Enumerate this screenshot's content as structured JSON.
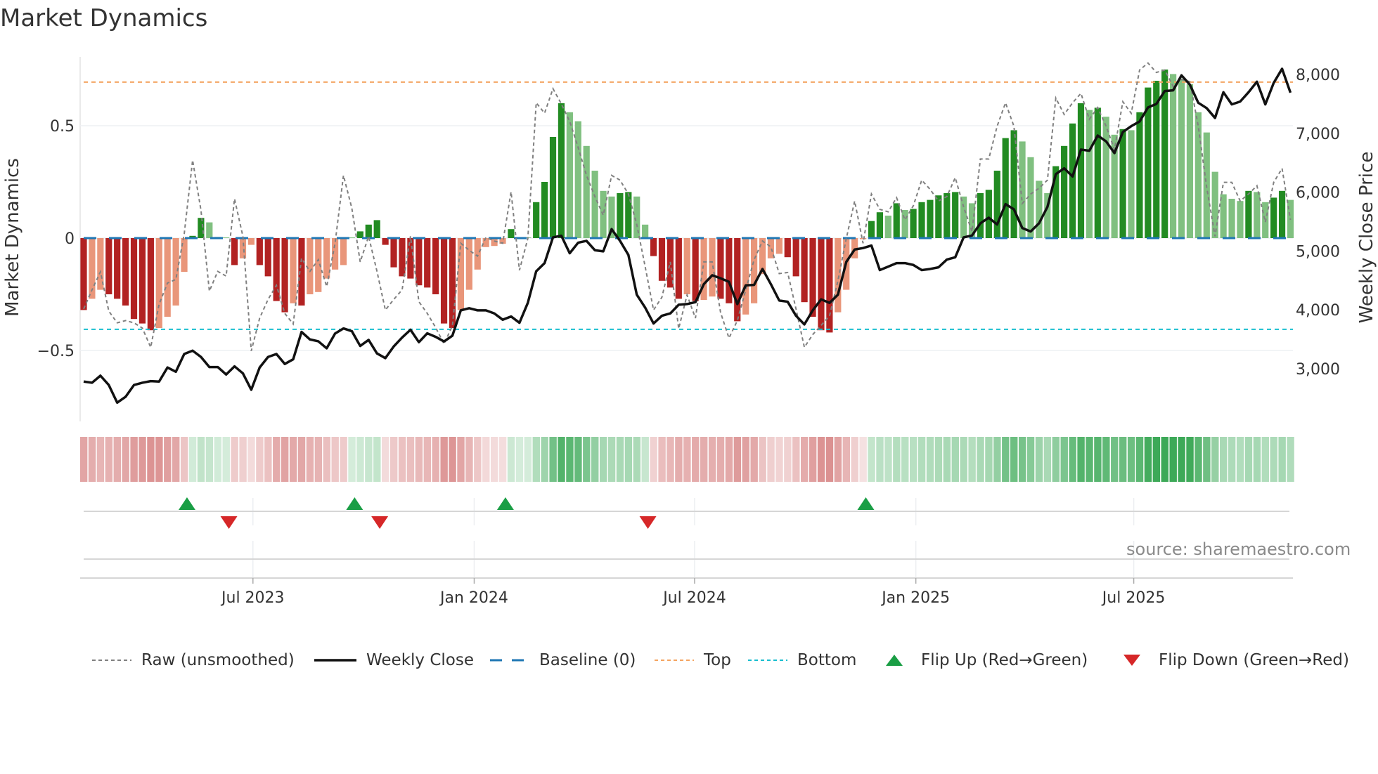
{
  "chart_data": {
    "type": "bar",
    "title": "Market Dynamics",
    "ylabel": "Market Dynamics",
    "y2label": "Weekly Close Price",
    "ylim": [
      -0.82,
      0.82
    ],
    "y2lim": [
      2000,
      8240
    ],
    "yticks": [
      {
        "value": 0.5,
        "label": "0.5"
      },
      {
        "value": 0,
        "label": "0"
      },
      {
        "value": -0.5,
        "label": "−0.5"
      }
    ],
    "y2ticks": [
      {
        "value": 8000,
        "label": "8,000"
      },
      {
        "value": 7000,
        "label": "7,000"
      },
      {
        "value": 6000,
        "label": "6,000"
      },
      {
        "value": 5000,
        "label": "5,000"
      },
      {
        "value": 4000,
        "label": "4,000"
      },
      {
        "value": 3000,
        "label": "3,000"
      }
    ],
    "xticks": [
      {
        "week": 20.2,
        "label": "Jul 2023"
      },
      {
        "week": 46.6,
        "label": "Jan 2024"
      },
      {
        "week": 72.9,
        "label": "Jul 2024"
      },
      {
        "week": 99.3,
        "label": "Jan 2025"
      },
      {
        "week": 125.3,
        "label": "Jul 2025"
      }
    ],
    "top_level": 0.694,
    "bottom_level": -0.406,
    "baseline": 0,
    "smoothed": [
      -0.32,
      -0.27,
      -0.23,
      -0.25,
      -0.27,
      -0.3,
      -0.36,
      -0.38,
      -0.41,
      -0.4,
      -0.35,
      -0.3,
      -0.15,
      0.01,
      0.09,
      0.07,
      0.005,
      0.003,
      -0.12,
      -0.09,
      -0.03,
      -0.12,
      -0.17,
      -0.28,
      -0.33,
      -0.29,
      -0.3,
      -0.25,
      -0.24,
      -0.18,
      -0.14,
      -0.12,
      0.003,
      0.03,
      0.06,
      0.08,
      -0.03,
      -0.13,
      -0.17,
      -0.18,
      -0.21,
      -0.22,
      -0.25,
      -0.38,
      -0.4,
      -0.32,
      -0.23,
      -0.14,
      -0.04,
      -0.035,
      -0.025,
      0.04,
      0.003,
      0.003,
      0.16,
      0.25,
      0.45,
      0.6,
      0.56,
      0.52,
      0.41,
      0.3,
      0.21,
      0.185,
      0.2,
      0.205,
      0.185,
      0.06,
      -0.08,
      -0.19,
      -0.22,
      -0.27,
      -0.25,
      -0.28,
      -0.275,
      -0.26,
      -0.27,
      -0.29,
      -0.37,
      -0.34,
      -0.29,
      -0.16,
      -0.09,
      -0.07,
      -0.085,
      -0.17,
      -0.285,
      -0.35,
      -0.41,
      -0.42,
      -0.33,
      -0.23,
      -0.09,
      -0.005,
      0.076,
      0.115,
      0.1,
      0.155,
      0.125,
      0.13,
      0.16,
      0.17,
      0.19,
      0.2,
      0.205,
      0.185,
      0.155,
      0.2,
      0.215,
      0.3,
      0.445,
      0.48,
      0.43,
      0.36,
      0.255,
      0.2,
      0.32,
      0.41,
      0.51,
      0.6,
      0.57,
      0.58,
      0.54,
      0.46,
      0.485,
      0.48,
      0.56,
      0.67,
      0.7,
      0.75,
      0.73,
      0.71,
      0.685,
      0.56,
      0.47,
      0.295,
      0.195,
      0.175,
      0.165,
      0.21,
      0.205,
      0.16,
      0.18,
      0.21,
      0.17
    ],
    "strong": [
      1,
      0,
      0,
      1,
      1,
      1,
      1,
      1,
      1,
      0,
      0,
      0,
      0,
      1,
      1,
      0,
      1,
      0,
      1,
      0,
      0,
      1,
      1,
      1,
      1,
      0,
      1,
      0,
      0,
      0,
      0,
      0,
      0,
      1,
      1,
      1,
      1,
      1,
      1,
      1,
      1,
      1,
      1,
      1,
      1,
      0,
      0,
      0,
      0,
      0,
      0,
      1,
      0,
      0,
      1,
      1,
      1,
      1,
      0,
      0,
      0,
      0,
      0,
      0,
      1,
      1,
      0,
      0,
      1,
      1,
      1,
      1,
      0,
      1,
      0,
      0,
      1,
      1,
      1,
      0,
      0,
      0,
      0,
      0,
      1,
      1,
      1,
      1,
      1,
      1,
      0,
      0,
      0,
      0,
      1,
      1,
      0,
      1,
      0,
      1,
      1,
      1,
      1,
      1,
      1,
      0,
      0,
      1,
      1,
      1,
      1,
      1,
      0,
      0,
      0,
      0,
      1,
      1,
      1,
      1,
      0,
      1,
      0,
      0,
      1,
      0,
      1,
      1,
      1,
      1,
      0,
      0,
      0,
      0,
      0,
      0,
      0,
      0,
      0,
      1,
      0,
      0,
      1,
      1,
      0
    ],
    "raw": [
      -0.315,
      -0.23,
      -0.15,
      -0.325,
      -0.377,
      -0.367,
      -0.377,
      -0.4,
      -0.486,
      -0.294,
      -0.2,
      -0.184,
      0.019,
      0.347,
      0.123,
      -0.236,
      -0.148,
      -0.169,
      0.175,
      0.008,
      -0.502,
      -0.356,
      -0.273,
      -0.21,
      -0.335,
      -0.382,
      -0.09,
      -0.148,
      -0.096,
      -0.216,
      -0.023,
      0.279,
      0.133,
      -0.106,
      0.008,
      -0.148,
      -0.32,
      -0.273,
      -0.23,
      0.008,
      -0.283,
      -0.335,
      -0.398,
      -0.471,
      -0.39,
      -0.023,
      -0.054,
      -0.08,
      0.003,
      -0.013,
      -0.023,
      0.206,
      -0.143,
      -0.002,
      0.602,
      0.556,
      0.665,
      0.597,
      0.519,
      0.404,
      0.279,
      0.185,
      0.102,
      0.279,
      0.258,
      0.196,
      0.06,
      -0.127,
      -0.32,
      -0.263,
      -0.106,
      -0.403,
      -0.253,
      -0.356,
      -0.106,
      -0.106,
      -0.331,
      -0.445,
      -0.367,
      -0.231,
      -0.096,
      -0.013,
      -0.039,
      -0.158,
      -0.153,
      -0.315,
      -0.486,
      -0.429,
      -0.388,
      -0.346,
      -0.19,
      -0.002,
      0.165,
      -0.023,
      0.196,
      0.128,
      0.117,
      0.18,
      0.081,
      0.144,
      0.258,
      0.217,
      0.165,
      0.185,
      0.269,
      0.139,
      0.029,
      0.352,
      0.352,
      0.498,
      0.602,
      0.498,
      0.154,
      0.196,
      0.222,
      0.258,
      0.623,
      0.55,
      0.602,
      0.644,
      0.529,
      0.581,
      0.498,
      0.394,
      0.607,
      0.555,
      0.748,
      0.779,
      0.737,
      0.748,
      0.675,
      0.706,
      0.696,
      0.498,
      0.227,
      0.008,
      0.248,
      0.248,
      0.165,
      0.196,
      0.233,
      0.071,
      0.248,
      0.31,
      0.081
    ],
    "weekly_close": [
      2782,
      2762,
      2882,
      2723,
      2424,
      2523,
      2723,
      2762,
      2790,
      2782,
      3021,
      2949,
      3251,
      3307,
      3200,
      3029,
      3029,
      2902,
      3041,
      2922,
      2643,
      3021,
      3200,
      3251,
      3081,
      3160,
      3626,
      3498,
      3466,
      3347,
      3598,
      3685,
      3638,
      3387,
      3490,
      3260,
      3180,
      3379,
      3530,
      3662,
      3451,
      3602,
      3542,
      3463,
      3562,
      3992,
      4028,
      3992,
      3992,
      3940,
      3833,
      3888,
      3781,
      4119,
      4656,
      4795,
      5232,
      5260,
      4962,
      5141,
      5173,
      5014,
      4994,
      5372,
      5173,
      4934,
      4258,
      4039,
      3769,
      3900,
      3940,
      4087,
      4099,
      4131,
      4437,
      4588,
      4536,
      4477,
      4099,
      4417,
      4425,
      4695,
      4437,
      4159,
      4139,
      3900,
      3753,
      3992,
      4179,
      4119,
      4258,
      4815,
      5026,
      5050,
      5093,
      4676,
      4735,
      4795,
      4795,
      4763,
      4676,
      4695,
      4723,
      4855,
      4894,
      5232,
      5264,
      5471,
      5566,
      5451,
      5797,
      5709,
      5391,
      5332,
      5471,
      5749,
      6306,
      6405,
      6266,
      6724,
      6704,
      6962,
      6863,
      6664,
      7022,
      7121,
      7201,
      7439,
      7499,
      7718,
      7730,
      7985,
      7826,
      7519,
      7428,
      7261,
      7698,
      7491,
      7539,
      7698,
      7877,
      7491,
      7857,
      8096,
      7690
    ],
    "flip_up_weeks": [
      13,
      33,
      51,
      94
    ],
    "flip_down_weeks": [
      18,
      36,
      68
    ],
    "legend": {
      "placement": "bottom",
      "raw": "Raw (unsmoothed)",
      "close": "Weekly Close",
      "baseline": "Baseline (0)",
      "top": "Top",
      "bottom": "Bottom",
      "flip_up": "Flip Up (Red→Green)",
      "flip_down": "Flip Down (Green→Red)"
    },
    "source": "source: sharemaestro.com",
    "colors": {
      "neg_strong": "#b22222",
      "neg_weak": "#e9967a",
      "pos_strong": "#228b22",
      "pos_weak": "#80c080",
      "raw": "#808080",
      "close": "#111111",
      "baseline": "#1f77b4",
      "top": "#f4a460",
      "bottom": "#17becf",
      "flip_up": "#1a9e45",
      "flip_down": "#d62728"
    }
  }
}
